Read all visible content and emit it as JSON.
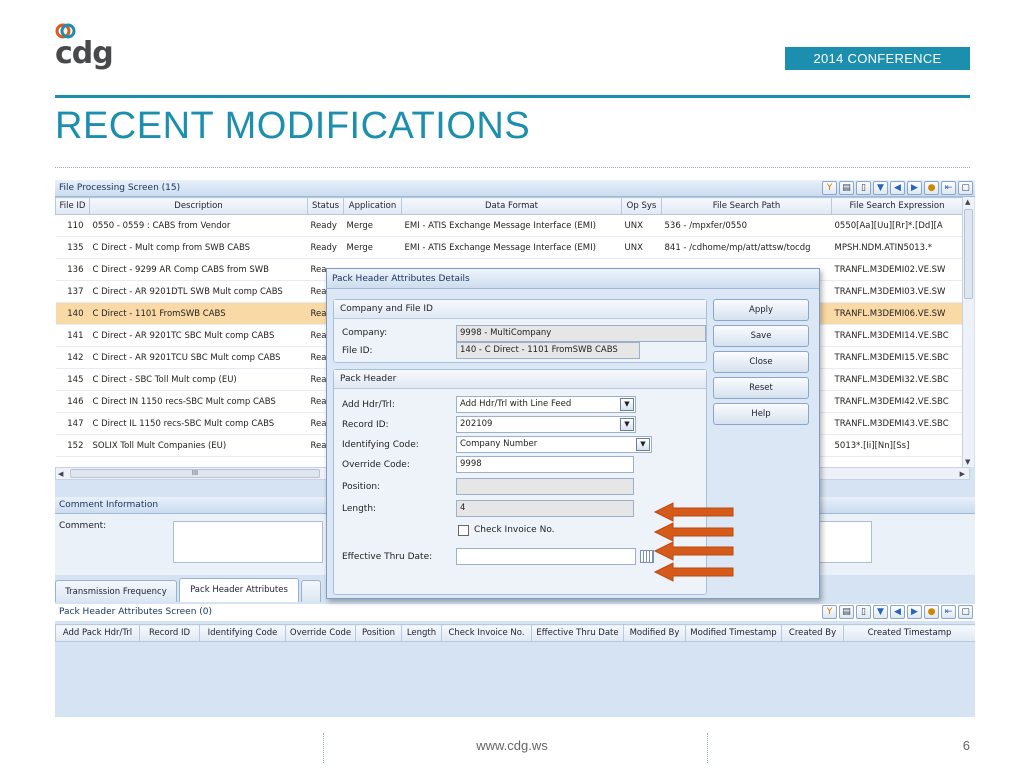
{
  "slide": {
    "logo_text": "cdg",
    "conference": "2014 CONFERENCE",
    "title": "RECENT MODIFICATIONS",
    "footer_url": "www.cdg.ws",
    "page_number": "6",
    "accent_color": "#1c8fae"
  },
  "top_panel": {
    "title": "File Processing Screen (15)",
    "columns": [
      "File ID",
      "Description",
      "Status",
      "Application",
      "Data Format",
      "Op Sys",
      "File Search Path",
      "File Search Expression"
    ],
    "rows": [
      {
        "id": "110",
        "desc": "0550 - 0559 : CABS from Vendor",
        "status": "Ready",
        "app": "Merge",
        "format": "EMI - ATIS Exchange Message Interface (EMI)",
        "os": "UNX",
        "path": "536 - /mpxfer/0550",
        "expr": "0550[Aa][Uu][Rr]*.[Dd][A"
      },
      {
        "id": "135",
        "desc": "C Direct - Mult comp from SWB CABS",
        "status": "Ready",
        "app": "Merge",
        "format": "EMI - ATIS Exchange Message Interface (EMI)",
        "os": "UNX",
        "path": "841 - /cdhome/mp/att/attsw/tocdg",
        "expr": "MPSH.NDM.ATIN5013.*"
      },
      {
        "id": "136",
        "desc": "C Direct - 9299 AR Comp CABS from SWB",
        "status": "Rea",
        "app": "",
        "format": "",
        "os": "",
        "path": "",
        "expr": "TRANFL.M3DEMI02.VE.SW"
      },
      {
        "id": "137",
        "desc": "C Direct - AR 9201DTL SWB Mult comp CABS",
        "status": "Rea",
        "app": "",
        "format": "",
        "os": "",
        "path": "",
        "expr": "TRANFL.M3DEMI03.VE.SW"
      },
      {
        "id": "140",
        "desc": "C Direct - 1101 FromSWB CABS",
        "status": "Rea",
        "app": "",
        "format": "",
        "os": "",
        "path": "",
        "expr": "TRANFL.M3DEMI06.VE.SW",
        "selected": true
      },
      {
        "id": "141",
        "desc": "C Direct - AR 9201TC SBC Mult comp CABS",
        "status": "Rea",
        "app": "",
        "format": "",
        "os": "",
        "path": "",
        "expr": "TRANFL.M3DEMI14.VE.SBC"
      },
      {
        "id": "142",
        "desc": "C Direct - AR 9201TCU SBC Mult comp CABS",
        "status": "Rea",
        "app": "",
        "format": "",
        "os": "",
        "path": "",
        "expr": "TRANFL.M3DEMI15.VE.SBC"
      },
      {
        "id": "145",
        "desc": "C Direct - SBC Toll Mult comp (EU)",
        "status": "Rea",
        "app": "",
        "format": "",
        "os": "",
        "path": "",
        "expr": "TRANFL.M3DEMI32.VE.SBC"
      },
      {
        "id": "146",
        "desc": "C Direct IN 1150 recs-SBC Mult comp CABS",
        "status": "Rea",
        "app": "",
        "format": "",
        "os": "",
        "path": "",
        "expr": "TRANFL.M3DEMI42.VE.SBC"
      },
      {
        "id": "147",
        "desc": "C Direct IL 1150 recs-SBC Mult comp CABS",
        "status": "Rea",
        "app": "",
        "format": "",
        "os": "",
        "path": "",
        "expr": "TRANFL.M3DEMI43.VE.SBC"
      },
      {
        "id": "152",
        "desc": "SOLIX Toll Mult Companies (EU)",
        "status": "Rea",
        "app": "",
        "format": "",
        "os": "",
        "path": "",
        "expr": "5013*.[Ii][Nn][Ss]"
      }
    ],
    "hscroll_thumb": "III"
  },
  "comment": {
    "header": "Comment Information",
    "label": "Comment:"
  },
  "tabs": [
    "Transmission Frequency",
    "Pack Header Attributes"
  ],
  "lower_panel": {
    "title": "Pack Header Attributes Screen (0)",
    "columns": [
      "Add Pack Hdr/Trl",
      "Record ID",
      "Identifying Code",
      "Override Code",
      "Position",
      "Length",
      "Check Invoice No.",
      "Effective Thru Date",
      "Modified By",
      "Modified Timestamp",
      "Created By",
      "Created Timestamp"
    ]
  },
  "dialog": {
    "title": "Pack Header Attributes Details",
    "company_group": {
      "title": "Company and File ID",
      "company_label": "Company:",
      "company_value": "9998 - MultiCompany",
      "file_label": "File ID:",
      "file_value": "140 - C Direct - 1101 FromSWB CABS"
    },
    "pack_group": {
      "title": "Pack Header",
      "add_label": "Add Hdr/Trl:",
      "add_value": "Add Hdr/Trl with Line Feed",
      "record_label": "Record ID:",
      "record_value": "202109",
      "ident_label": "Identifying Code:",
      "ident_value": "Company Number",
      "override_label": "Override Code:",
      "override_value": "9998",
      "position_label": "Position:",
      "position_value": "",
      "length_label": "Length:",
      "length_value": "4",
      "check_label": "Check Invoice No.",
      "eff_label": "Effective Thru Date:",
      "eff_value": ""
    },
    "buttons": {
      "apply": "Apply",
      "save": "Save",
      "close": "Close",
      "reset": "Reset",
      "help": "Help"
    }
  }
}
